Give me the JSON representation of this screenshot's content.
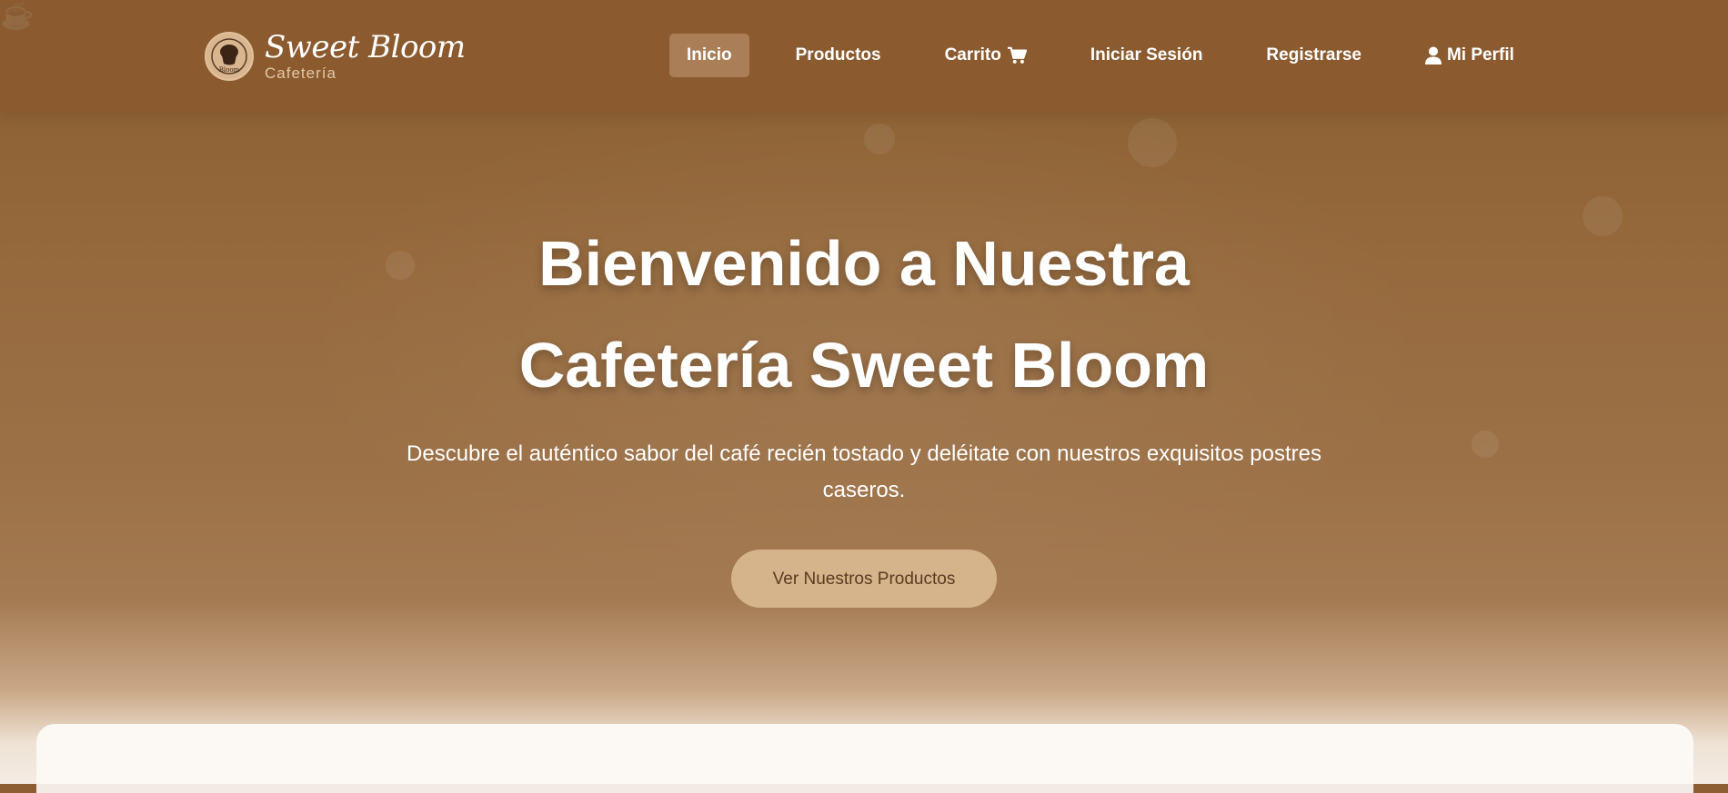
{
  "brand": {
    "name": "Sweet Bloom",
    "subtitle": "Cafetería"
  },
  "nav": {
    "items": [
      {
        "label": "Inicio",
        "active": true
      },
      {
        "label": "Productos"
      },
      {
        "label": "Carrito",
        "icon": "cart-icon"
      },
      {
        "label": "Iniciar Sesión"
      },
      {
        "label": "Registrarse"
      },
      {
        "label": "Mi Perfil",
        "icon": "user-icon"
      }
    ]
  },
  "hero": {
    "title_line1": "Bienvenido a Nuestra",
    "title_line2": "Cafetería Sweet Bloom",
    "description": "Descubre el auténtico sabor del café recién tostado y deléitate con nuestros exquisitos postres caseros.",
    "cta_label": "Ver Nuestros Productos"
  },
  "colors": {
    "header_bg": "#8b5b2f",
    "active_nav_bg": "#aa7e57",
    "cta_bg": "#d5b48b",
    "cta_text": "#5a3b22",
    "card_bg": "#fcf8f4"
  }
}
